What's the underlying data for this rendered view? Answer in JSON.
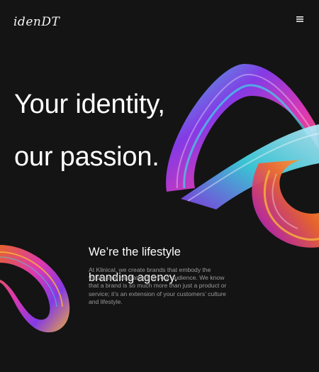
{
  "header": {
    "logo_text": "idenDT",
    "menu_icon": "hamburger-menu-icon"
  },
  "hero": {
    "title_line1": "Your identity,",
    "title_line2": "our passion."
  },
  "about": {
    "heading_line1": "We’re the lifestyle",
    "heading_line2": "branding agency.",
    "body": "At Klinical, we create brands that embody the values and aspirations of your audience. We know that a brand is so much more than just a product or service; it’s an extension of your customers’ culture and lifestyle."
  },
  "artwork": {
    "main_shape": "abstract-3d-ribbon-swirl",
    "corner_shape": "abstract-3d-ribbon-ring",
    "colors": [
      "#3fd6e8",
      "#8a3cf0",
      "#e83ab8",
      "#f0672f",
      "#f7b53a"
    ]
  }
}
